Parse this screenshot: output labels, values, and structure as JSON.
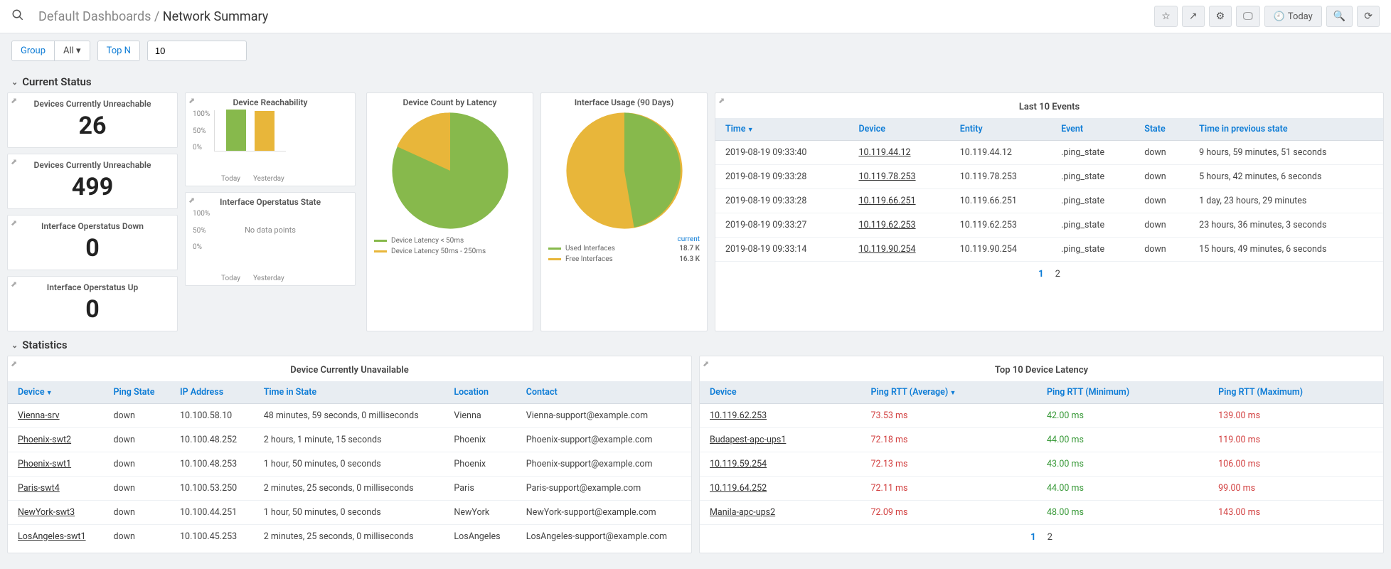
{
  "header": {
    "breadcrumb_parent": "Default Dashboards",
    "breadcrumb_current": "Network Summary",
    "today_label": "Today"
  },
  "filters": {
    "group_label": "Group",
    "all_label": "All",
    "topn_label": "Top N",
    "topn_value": "10"
  },
  "sections": {
    "status": "Current Status",
    "stats": "Statistics"
  },
  "kpis": [
    {
      "title": "Devices Currently Unreachable",
      "value": "26"
    },
    {
      "title": "Devices Currently Unreachable",
      "value": "499"
    },
    {
      "title": "Interface Operstatus Down",
      "value": "0"
    },
    {
      "title": "Interface Operstatus Up",
      "value": "0"
    }
  ],
  "mini_charts": {
    "reach": {
      "title": "Device Reachability",
      "y": [
        "100%",
        "50%",
        "0%"
      ],
      "x": [
        "Today",
        "Yesterday"
      ],
      "heights": [
        58,
        56
      ]
    },
    "oper": {
      "title": "Interface Operstatus State",
      "y": [
        "100%",
        "50%",
        "0%"
      ],
      "x": [
        "Today",
        "Yesterday"
      ],
      "nodata": "No data points"
    }
  },
  "pie_latency": {
    "title": "Device Count by Latency",
    "legend": [
      {
        "label": "Device Latency < 50ms",
        "color": "g"
      },
      {
        "label": "Device Latency 50ms - 250ms",
        "color": "y"
      }
    ]
  },
  "pie_ifusage": {
    "title": "Interface Usage (90 Days)",
    "current_label": "current",
    "legend": [
      {
        "label": "Used Interfaces",
        "color": "g",
        "val": "18.7 K"
      },
      {
        "label": "Free Interfaces",
        "color": "y",
        "val": "16.3 K"
      }
    ]
  },
  "events": {
    "title": "Last 10 Events",
    "cols": [
      "Time",
      "Device",
      "Entity",
      "Event",
      "State",
      "Time in previous state"
    ],
    "rows": [
      [
        "2019-08-19 09:33:40",
        "10.119.44.12",
        "10.119.44.12",
        ".ping_state",
        "down",
        "9 hours, 59 minutes, 51 seconds"
      ],
      [
        "2019-08-19 09:33:28",
        "10.119.78.253",
        "10.119.78.253",
        ".ping_state",
        "down",
        "5 hours, 42 minutes, 6 seconds"
      ],
      [
        "2019-08-19 09:33:28",
        "10.119.66.251",
        "10.119.66.251",
        ".ping_state",
        "down",
        "1 day, 23 hours, 29 minutes"
      ],
      [
        "2019-08-19 09:33:27",
        "10.119.62.253",
        "10.119.62.253",
        ".ping_state",
        "down",
        "23 hours, 36 minutes, 3 seconds"
      ],
      [
        "2019-08-19 09:33:14",
        "10.119.90.254",
        "10.119.90.254",
        ".ping_state",
        "down",
        "15 hours, 49 minutes, 6 seconds"
      ]
    ],
    "pages": [
      "1",
      "2"
    ]
  },
  "unavail": {
    "title": "Device Currently Unavailable",
    "cols": [
      "Device",
      "Ping State",
      "IP Address",
      "Time in State",
      "Location",
      "Contact"
    ],
    "rows": [
      [
        "Vienna-srv",
        "down",
        "10.100.58.10",
        "48 minutes, 59 seconds, 0 milliseconds",
        "Vienna",
        "Vienna-support@example.com"
      ],
      [
        "Phoenix-swt2",
        "down",
        "10.100.48.252",
        "2 hours, 1 minute, 15 seconds",
        "Phoenix",
        "Phoenix-support@example.com"
      ],
      [
        "Phoenix-swt1",
        "down",
        "10.100.48.253",
        "1 hour, 50 minutes, 0 seconds",
        "Phoenix",
        "Phoenix-support@example.com"
      ],
      [
        "Paris-swt4",
        "down",
        "10.100.53.250",
        "2 minutes, 25 seconds, 0 milliseconds",
        "Paris",
        "Paris-support@example.com"
      ],
      [
        "NewYork-swt3",
        "down",
        "10.100.44.251",
        "1 hour, 50 minutes, 0 seconds",
        "NewYork",
        "NewYork-support@example.com"
      ],
      [
        "LosAngeles-swt1",
        "down",
        "10.100.45.253",
        "2 minutes, 25 seconds, 0 milliseconds",
        "LosAngeles",
        "LosAngeles-support@example.com"
      ]
    ]
  },
  "latency": {
    "title": "Top 10 Device Latency",
    "cols": [
      "Device",
      "Ping RTT (Average)",
      "Ping RTT (Minimum)",
      "Ping RTT (Maximum)"
    ],
    "rows": [
      [
        "10.119.62.253",
        "73.53 ms",
        "42.00 ms",
        "139.00 ms"
      ],
      [
        "Budapest-apc-ups1",
        "72.18 ms",
        "44.00 ms",
        "119.00 ms"
      ],
      [
        "10.119.59.254",
        "72.13 ms",
        "43.00 ms",
        "106.00 ms"
      ],
      [
        "10.119.64.252",
        "72.11 ms",
        "44.00 ms",
        "99.00 ms"
      ],
      [
        "Manila-apc-ups2",
        "72.09 ms",
        "48.00 ms",
        "143.00 ms"
      ]
    ],
    "pages": [
      "1",
      "2"
    ]
  },
  "chart_data": [
    {
      "type": "bar",
      "title": "Device Reachability",
      "categories": [
        "Today",
        "Yesterday"
      ],
      "values": [
        100,
        96
      ],
      "ylabel": "",
      "ylim": [
        0,
        100
      ]
    },
    {
      "type": "bar",
      "title": "Interface Operstatus State",
      "categories": [
        "Today",
        "Yesterday"
      ],
      "values": [],
      "note": "No data points",
      "ylim": [
        0,
        100
      ]
    },
    {
      "type": "pie",
      "title": "Device Count by Latency",
      "series": [
        {
          "name": "Device Latency < 50ms",
          "value": 85
        },
        {
          "name": "Device Latency 50ms - 250ms",
          "value": 15
        }
      ]
    },
    {
      "type": "pie",
      "title": "Interface Usage (90 Days)",
      "series": [
        {
          "name": "Used Interfaces",
          "value": 18700
        },
        {
          "name": "Free Interfaces",
          "value": 16300
        }
      ]
    }
  ]
}
